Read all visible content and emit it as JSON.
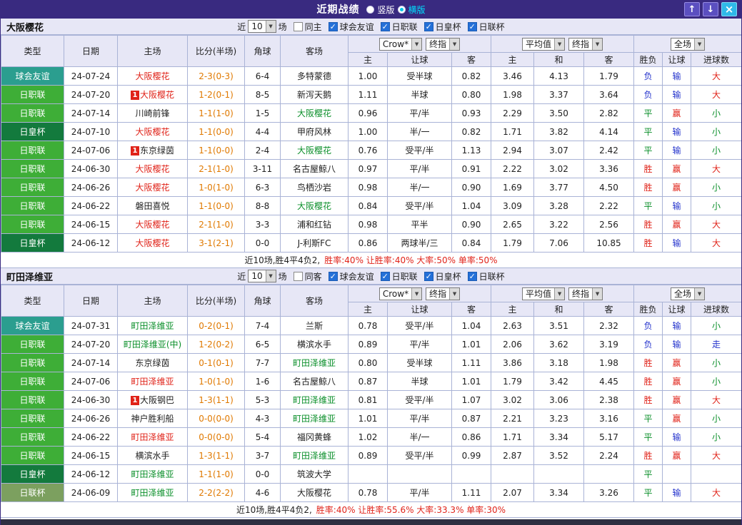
{
  "titlebar": {
    "title": "近期战绩",
    "radio_vertical": "竖版",
    "radio_horizontal": "横版"
  },
  "icons": {
    "up_arrow": "↑",
    "down_arrow": "↓",
    "close": "×",
    "dropdown": "▼"
  },
  "labels": {
    "near": "近",
    "matches": "场",
    "leagues": [
      "球会友谊",
      "日职联",
      "日皇杯",
      "日联杯"
    ]
  },
  "controls": {
    "odds_source": "Crow*",
    "final_index": "终指",
    "average": "平均值",
    "full_match": "全场"
  },
  "table_headers": {
    "type": "类型",
    "date": "日期",
    "home": "主场",
    "score": "比分(半场)",
    "corner": "角球",
    "away": "客场",
    "odds_home": "主",
    "odds_handicap": "让球",
    "odds_away": "客",
    "avg_home": "主",
    "avg_draw": "和",
    "avg_away": "客",
    "result_wdl": "胜负",
    "result_handicap": "让球",
    "result_goals": "进球数"
  },
  "colors": {
    "titlebar_bg": "#392a80",
    "accent_cyan": "#00e0ff",
    "header_bg": "#e7e7f6",
    "border": "#a9b3d6",
    "type_colors": {
      "球会友谊": "#2b9e8f",
      "日职联": "#3eae37",
      "日皇杯": "#137a3d",
      "日联杯": "#7ca05f"
    },
    "team_colors": {
      "red": "#e02319",
      "green": "#0b8f2a",
      "black": "#222222"
    },
    "score_color": "#e07900",
    "value_colors": {
      "胜": "#e02319",
      "平": "#0b8f2a",
      "负": "#2433cc",
      "赢": "#e02319",
      "输": "#2433cc",
      "大": "#e02319",
      "小": "#0b8f2a",
      "走": "#2433cc"
    }
  },
  "sections": [
    {
      "team": "大阪樱花",
      "filters": {
        "count": "10",
        "same_label": "同主",
        "same_checked": false
      },
      "rows": [
        {
          "type": "球会友谊",
          "date": "24-07-24",
          "home": {
            "name": "大阪樱花",
            "color": "red"
          },
          "score": "2-3(0-3)",
          "corner": "6-4",
          "away": {
            "name": "多特蒙德",
            "color": "black"
          },
          "odds": [
            "1.00",
            "受半球",
            "0.82"
          ],
          "avg": [
            "3.46",
            "4.13",
            "1.79"
          ],
          "res": [
            "负",
            "输",
            "大"
          ]
        },
        {
          "type": "日职联",
          "date": "24-07-20",
          "home": {
            "name": "大阪樱花",
            "color": "red",
            "badge": "1"
          },
          "score": "1-2(0-1)",
          "corner": "8-5",
          "away": {
            "name": "新泻天鹅",
            "color": "black"
          },
          "odds": [
            "1.11",
            "半球",
            "0.80"
          ],
          "avg": [
            "1.98",
            "3.37",
            "3.64"
          ],
          "res": [
            "负",
            "输",
            "大"
          ]
        },
        {
          "type": "日职联",
          "date": "24-07-14",
          "home": {
            "name": "川崎前锋",
            "color": "black"
          },
          "score": "1-1(1-0)",
          "corner": "1-5",
          "away": {
            "name": "大阪樱花",
            "color": "green"
          },
          "odds": [
            "0.96",
            "平/半",
            "0.93"
          ],
          "avg": [
            "2.29",
            "3.50",
            "2.82"
          ],
          "res": [
            "平",
            "赢",
            "小"
          ]
        },
        {
          "type": "日皇杯",
          "date": "24-07-10",
          "home": {
            "name": "大阪樱花",
            "color": "red"
          },
          "score": "1-1(0-0)",
          "corner": "4-4",
          "away": {
            "name": "甲府风林",
            "color": "black"
          },
          "odds": [
            "1.00",
            "半/一",
            "0.82"
          ],
          "avg": [
            "1.71",
            "3.82",
            "4.14"
          ],
          "res": [
            "平",
            "输",
            "小"
          ]
        },
        {
          "type": "日职联",
          "date": "24-07-06",
          "home": {
            "name": "东京绿茵",
            "color": "black",
            "badge": "1"
          },
          "score": "1-1(0-0)",
          "corner": "2-4",
          "away": {
            "name": "大阪樱花",
            "color": "green"
          },
          "odds": [
            "0.76",
            "受平/半",
            "1.13"
          ],
          "avg": [
            "2.94",
            "3.07",
            "2.42"
          ],
          "res": [
            "平",
            "输",
            "小"
          ]
        },
        {
          "type": "日职联",
          "date": "24-06-30",
          "home": {
            "name": "大阪樱花",
            "color": "red"
          },
          "score": "2-1(1-0)",
          "corner": "3-11",
          "away": {
            "name": "名古屋鲸八",
            "color": "black"
          },
          "odds": [
            "0.97",
            "平/半",
            "0.91"
          ],
          "avg": [
            "2.22",
            "3.02",
            "3.36"
          ],
          "res": [
            "胜",
            "赢",
            "大"
          ]
        },
        {
          "type": "日职联",
          "date": "24-06-26",
          "home": {
            "name": "大阪樱花",
            "color": "red"
          },
          "score": "1-0(1-0)",
          "corner": "6-3",
          "away": {
            "name": "鸟栖沙岩",
            "color": "black"
          },
          "odds": [
            "0.98",
            "半/一",
            "0.90"
          ],
          "avg": [
            "1.69",
            "3.77",
            "4.50"
          ],
          "res": [
            "胜",
            "赢",
            "小"
          ]
        },
        {
          "type": "日职联",
          "date": "24-06-22",
          "home": {
            "name": "磐田喜悦",
            "color": "black"
          },
          "score": "1-1(0-0)",
          "corner": "8-8",
          "away": {
            "name": "大阪樱花",
            "color": "green"
          },
          "odds": [
            "0.84",
            "受平/半",
            "1.04"
          ],
          "avg": [
            "3.09",
            "3.28",
            "2.22"
          ],
          "res": [
            "平",
            "输",
            "小"
          ]
        },
        {
          "type": "日职联",
          "date": "24-06-15",
          "home": {
            "name": "大阪樱花",
            "color": "red"
          },
          "score": "2-1(1-0)",
          "corner": "3-3",
          "away": {
            "name": "浦和红钻",
            "color": "black"
          },
          "odds": [
            "0.98",
            "平半",
            "0.90"
          ],
          "avg": [
            "2.65",
            "3.22",
            "2.56"
          ],
          "res": [
            "胜",
            "赢",
            "大"
          ]
        },
        {
          "type": "日皇杯",
          "date": "24-06-12",
          "home": {
            "name": "大阪樱花",
            "color": "red"
          },
          "score": "3-1(2-1)",
          "corner": "0-0",
          "away": {
            "name": "J-利斯FC",
            "color": "black"
          },
          "odds": [
            "0.86",
            "两球半/三",
            "0.84"
          ],
          "avg": [
            "1.79",
            "7.06",
            "10.85"
          ],
          "res": [
            "胜",
            "输",
            "大"
          ]
        }
      ],
      "footer": {
        "prefix": "近10场,胜4平4负2,",
        "stats": "胜率:40% 让胜率:40% 大率:50% 单率:50%"
      }
    },
    {
      "team": "町田泽维亚",
      "filters": {
        "count": "10",
        "same_label": "同客",
        "same_checked": false
      },
      "rows": [
        {
          "type": "球会友谊",
          "date": "24-07-31",
          "home": {
            "name": "町田泽维亚",
            "color": "green"
          },
          "score": "0-2(0-1)",
          "corner": "7-4",
          "away": {
            "name": "兰斯",
            "color": "black"
          },
          "odds": [
            "0.78",
            "受平/半",
            "1.04"
          ],
          "avg": [
            "2.63",
            "3.51",
            "2.32"
          ],
          "res": [
            "负",
            "输",
            "小"
          ]
        },
        {
          "type": "日职联",
          "date": "24-07-20",
          "home": {
            "name": "町田泽维亚(中)",
            "color": "green"
          },
          "score": "1-2(0-2)",
          "corner": "6-5",
          "away": {
            "name": "横滨水手",
            "color": "black"
          },
          "odds": [
            "0.89",
            "平/半",
            "1.01"
          ],
          "avg": [
            "2.06",
            "3.62",
            "3.19"
          ],
          "res": [
            "负",
            "输",
            "走"
          ]
        },
        {
          "type": "日职联",
          "date": "24-07-14",
          "home": {
            "name": "东京绿茵",
            "color": "black"
          },
          "score": "0-1(0-1)",
          "corner": "7-7",
          "away": {
            "name": "町田泽维亚",
            "color": "green"
          },
          "odds": [
            "0.80",
            "受半球",
            "1.11"
          ],
          "avg": [
            "3.86",
            "3.18",
            "1.98"
          ],
          "res": [
            "胜",
            "赢",
            "小"
          ]
        },
        {
          "type": "日职联",
          "date": "24-07-06",
          "home": {
            "name": "町田泽维亚",
            "color": "red"
          },
          "score": "1-0(1-0)",
          "corner": "1-6",
          "away": {
            "name": "名古屋鲸八",
            "color": "black"
          },
          "odds": [
            "0.87",
            "半球",
            "1.01"
          ],
          "avg": [
            "1.79",
            "3.42",
            "4.45"
          ],
          "res": [
            "胜",
            "赢",
            "小"
          ]
        },
        {
          "type": "日职联",
          "date": "24-06-30",
          "home": {
            "name": "大阪钢巴",
            "color": "black",
            "badge": "1"
          },
          "score": "1-3(1-1)",
          "corner": "5-3",
          "away": {
            "name": "町田泽维亚",
            "color": "green"
          },
          "odds": [
            "0.81",
            "受平/半",
            "1.07"
          ],
          "avg": [
            "3.02",
            "3.06",
            "2.38"
          ],
          "res": [
            "胜",
            "赢",
            "大"
          ]
        },
        {
          "type": "日职联",
          "date": "24-06-26",
          "home": {
            "name": "神户胜利船",
            "color": "black"
          },
          "score": "0-0(0-0)",
          "corner": "4-3",
          "away": {
            "name": "町田泽维亚",
            "color": "green"
          },
          "odds": [
            "1.01",
            "平/半",
            "0.87"
          ],
          "avg": [
            "2.21",
            "3.23",
            "3.16"
          ],
          "res": [
            "平",
            "赢",
            "小"
          ]
        },
        {
          "type": "日职联",
          "date": "24-06-22",
          "home": {
            "name": "町田泽维亚",
            "color": "red"
          },
          "score": "0-0(0-0)",
          "corner": "5-4",
          "away": {
            "name": "福冈黄蜂",
            "color": "black"
          },
          "odds": [
            "1.02",
            "半/一",
            "0.86"
          ],
          "avg": [
            "1.71",
            "3.34",
            "5.17"
          ],
          "res": [
            "平",
            "输",
            "小"
          ]
        },
        {
          "type": "日职联",
          "date": "24-06-15",
          "home": {
            "name": "横滨水手",
            "color": "black"
          },
          "score": "1-3(1-1)",
          "corner": "3-7",
          "away": {
            "name": "町田泽维亚",
            "color": "green"
          },
          "odds": [
            "0.89",
            "受平/半",
            "0.99"
          ],
          "avg": [
            "2.87",
            "3.52",
            "2.24"
          ],
          "res": [
            "胜",
            "赢",
            "大"
          ]
        },
        {
          "type": "日皇杯",
          "date": "24-06-12",
          "home": {
            "name": "町田泽维亚",
            "color": "green"
          },
          "score": "1-1(1-0)",
          "corner": "0-0",
          "away": {
            "name": "筑波大学",
            "color": "black"
          },
          "odds": [
            "",
            "",
            ""
          ],
          "avg": [
            "",
            "",
            ""
          ],
          "res": [
            "平",
            "",
            ""
          ]
        },
        {
          "type": "日联杯",
          "date": "24-06-09",
          "home": {
            "name": "町田泽维亚",
            "color": "green"
          },
          "score": "2-2(2-2)",
          "corner": "4-6",
          "away": {
            "name": "大阪樱花",
            "color": "black"
          },
          "odds": [
            "0.78",
            "平/半",
            "1.11"
          ],
          "avg": [
            "2.07",
            "3.34",
            "3.26"
          ],
          "res": [
            "平",
            "输",
            "大"
          ]
        }
      ],
      "footer": {
        "prefix": "近10场,胜4平4负2,",
        "stats": "胜率:40% 让胜率:55.6% 大率:33.3% 单率:30%"
      }
    }
  ]
}
